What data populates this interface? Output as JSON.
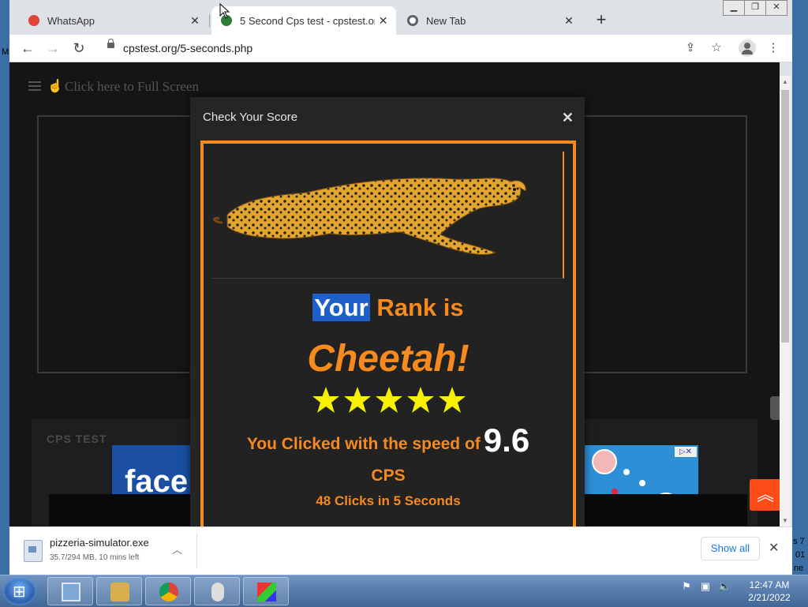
{
  "browser": {
    "tabs": [
      {
        "title": "WhatsApp",
        "favicon_color": "#e0453a"
      },
      {
        "title": "5 Second Cps test - cpstest.org",
        "favicon_color": "#2e7d32"
      },
      {
        "title": "New Tab",
        "favicon_color": "#5f6368"
      }
    ],
    "url": "cpstest.org/5-seconds.php"
  },
  "page": {
    "fullscreen_label": "Click here to Full Screen",
    "cps_section_label": "CPS TEST",
    "ad_text": "face"
  },
  "modal": {
    "title": "Check Your Score",
    "rank_highlight": "Your",
    "rank_rest": "Rank is",
    "rank_name": "Cheetah!",
    "stars": 5,
    "speed_text": "You Clicked with the speed of",
    "score": "9.6",
    "unit": "CPS",
    "clicks_summary": "48 Clicks in 5 Seconds"
  },
  "download": {
    "filename": "pizzeria-simulator.exe",
    "status": "35.7/294 MB, 10 mins left",
    "show_all": "Show all"
  },
  "taskbar": {
    "time": "12:47 AM",
    "date": "2/21/2022"
  },
  "desktop": {
    "left_char": "M",
    "right_lines": [
      "s 7",
      "01",
      "ne"
    ]
  }
}
